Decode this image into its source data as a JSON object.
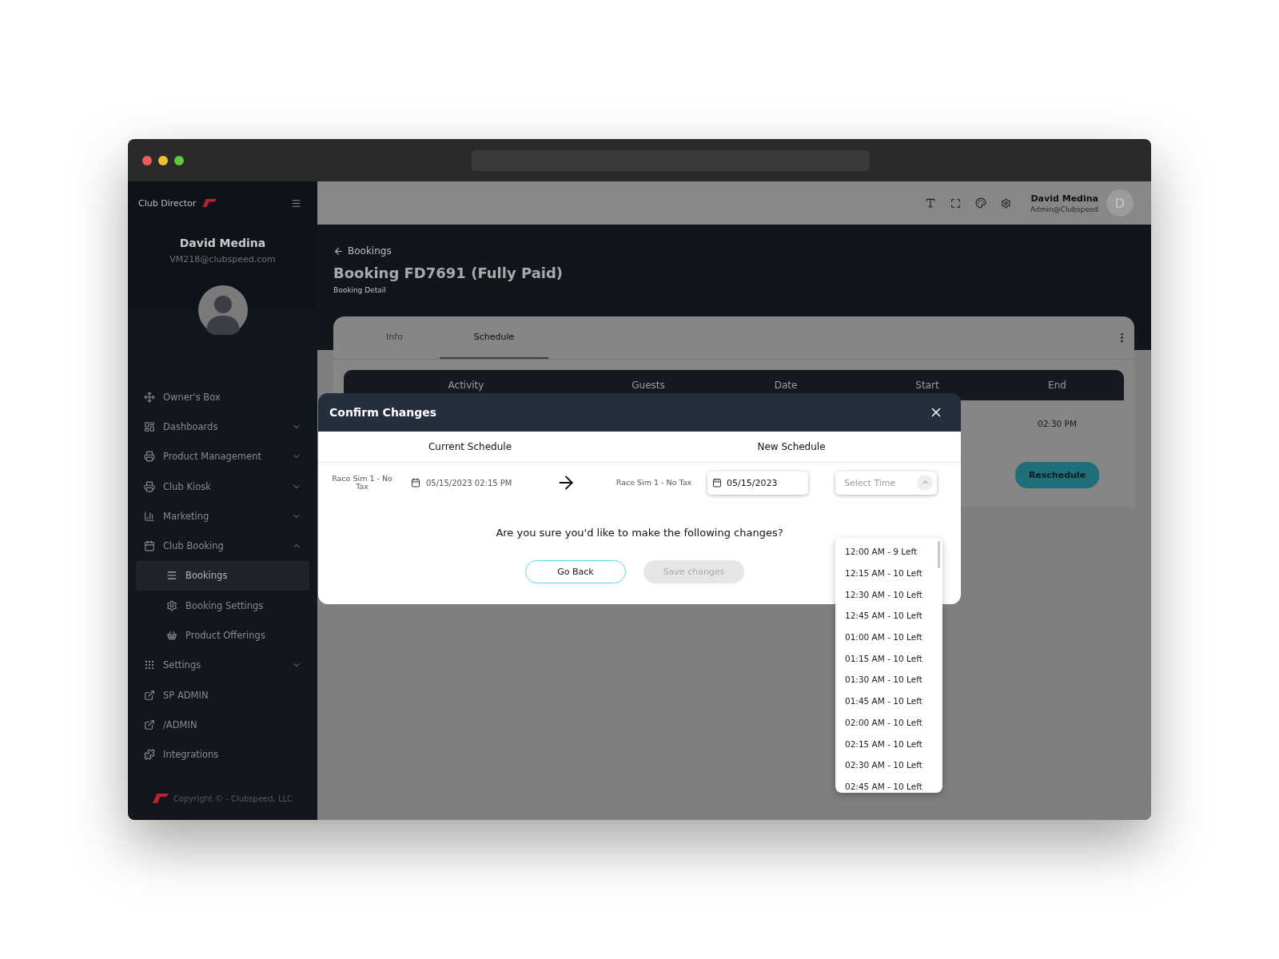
{
  "sidebar": {
    "brand": "Club Director",
    "user": {
      "name": "David Medina",
      "email": "VM218@clubspeed.com"
    },
    "items": [
      {
        "label": "Owner's Box",
        "selected": false
      },
      {
        "label": "Dashboards",
        "selected": false,
        "expanded": false
      },
      {
        "label": "Product Management",
        "selected": false,
        "expanded": false
      },
      {
        "label": "Club Kiosk",
        "selected": false,
        "expanded": false
      },
      {
        "label": "Marketing",
        "selected": false,
        "expanded": false
      },
      {
        "label": "Club Booking",
        "selected": false,
        "expanded": true,
        "children": [
          {
            "label": "Bookings",
            "selected": true
          },
          {
            "label": "Booking Settings",
            "selected": false
          },
          {
            "label": "Product Offerings",
            "selected": false
          }
        ]
      },
      {
        "label": "Settings",
        "selected": false,
        "expanded": false
      },
      {
        "label": "SP ADMIN",
        "selected": false
      },
      {
        "label": "/ADMIN",
        "selected": false
      },
      {
        "label": "Integrations",
        "selected": false
      }
    ],
    "copyright": "Copyright © - Clubspeed, LLC"
  },
  "topbar": {
    "user_name": "David Medina",
    "user_role": "Admin@Clubspeed",
    "avatar_letter": "D"
  },
  "page": {
    "back_link": "Bookings",
    "title": "Booking FD7691 (Fully Paid)",
    "subtitle": "Booking Detail"
  },
  "tabs": [
    {
      "label": "Info",
      "selected": false
    },
    {
      "label": "Schedule",
      "selected": true
    }
  ],
  "table": {
    "columns": [
      "Activity",
      "Guests",
      "Date",
      "Start",
      "End"
    ],
    "rows": [
      {
        "end": "02:30 PM",
        "action": "Reschedule"
      }
    ]
  },
  "dialog": {
    "title": "Confirm Changes",
    "current_heading": "Current Schedule",
    "new_heading": "New Schedule",
    "current": {
      "activity": "Race Sim 1 - No Tax",
      "datetime": "05/15/2023 02:15 PM"
    },
    "new": {
      "activity": "Race Sim 1 - No Tax",
      "date": "05/15/2023",
      "time_placeholder": "Select Time"
    },
    "question": "Are you sure you'd like to make the following changes?",
    "buttons": [
      {
        "label": "Go Back",
        "disabled": false
      },
      {
        "label": "Save changes",
        "disabled": true
      }
    ]
  },
  "time_options": [
    "12:00 AM - 9 Left",
    "12:15 AM - 10 Left",
    "12:30 AM - 10 Left",
    "12:45 AM - 10 Left",
    "01:00 AM - 10 Left",
    "01:15 AM - 10 Left",
    "01:30 AM - 10 Left",
    "01:45 AM - 10 Left",
    "02:00 AM - 10 Left",
    "02:15 AM - 10 Left",
    "02:30 AM - 10 Left",
    "02:45 AM - 10 Left"
  ]
}
